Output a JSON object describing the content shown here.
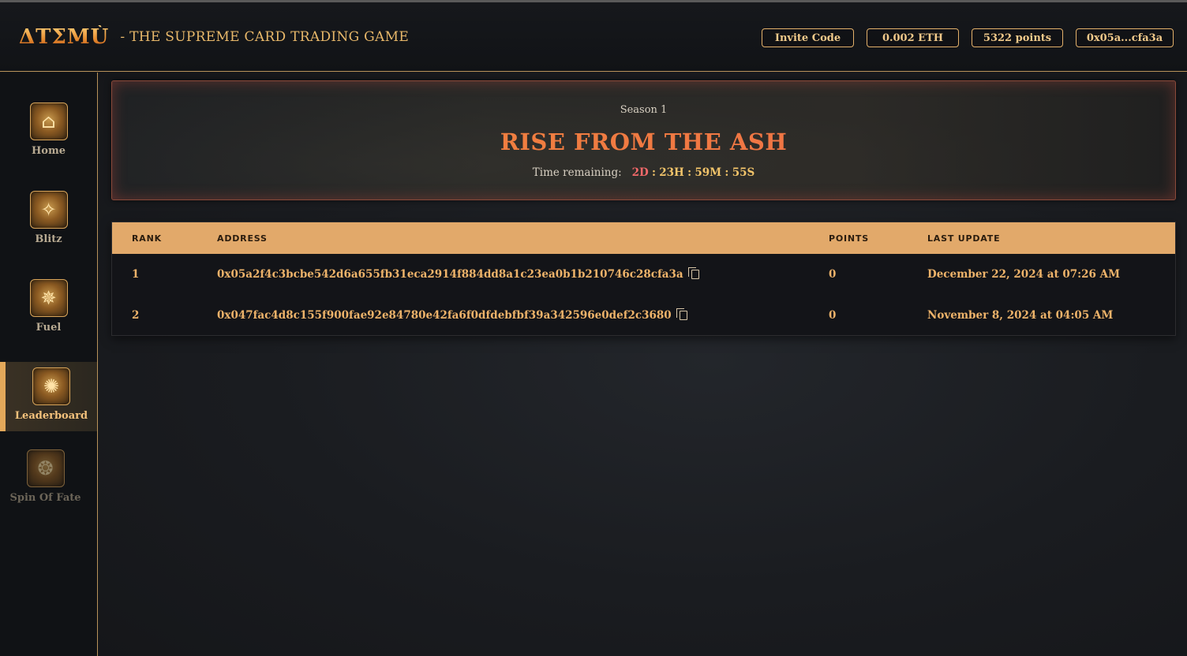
{
  "header": {
    "logo": "ΔΤΣΜÙ",
    "tagline": "- THE SUPREME CARD TRADING GAME",
    "buttons": {
      "invite": "Invite Code",
      "balance": "0.002 ETH",
      "points": "5322 points",
      "wallet": "0x05a...cfa3a"
    }
  },
  "sidebar": {
    "items": [
      {
        "label": "Home",
        "icon": "home-icon"
      },
      {
        "label": "Blitz",
        "icon": "blitz-icon"
      },
      {
        "label": "Fuel",
        "icon": "fuel-icon"
      },
      {
        "label": "Leaderboard",
        "icon": "leaderboard-icon",
        "active": true
      },
      {
        "label": "Spin Of Fate",
        "icon": "spin-icon",
        "disabled": true
      }
    ]
  },
  "banner": {
    "season": "Season 1",
    "title": "RISE FROM THE ASH",
    "timer_label": "Time remaining:",
    "days": "2D",
    "hours": "23H",
    "minutes": "59M",
    "seconds": "55S"
  },
  "table": {
    "headers": {
      "rank": "RANK",
      "address": "ADDRESS",
      "points": "POINTS",
      "updated": "LAST UPDATE"
    },
    "rows": [
      {
        "rank": "1",
        "address": "0x05a2f4c3bcbe542d6a655fb31eca2914f884dd8a1c23ea0b1b210746c28cfa3a",
        "points": "0",
        "updated": "December 22, 2024 at 07:26 AM"
      },
      {
        "rank": "2",
        "address": "0x047fac4d8c155f900fae92e84780e42fa6f0dfdebfbf39a342596e0def2c3680",
        "points": "0",
        "updated": "November 8, 2024 at 04:05 AM"
      }
    ]
  },
  "colors": {
    "accent": "#e2a96a",
    "title": "#f06a4a",
    "timer_days": "#f2696a",
    "timer_rest": "#f2c46a"
  }
}
